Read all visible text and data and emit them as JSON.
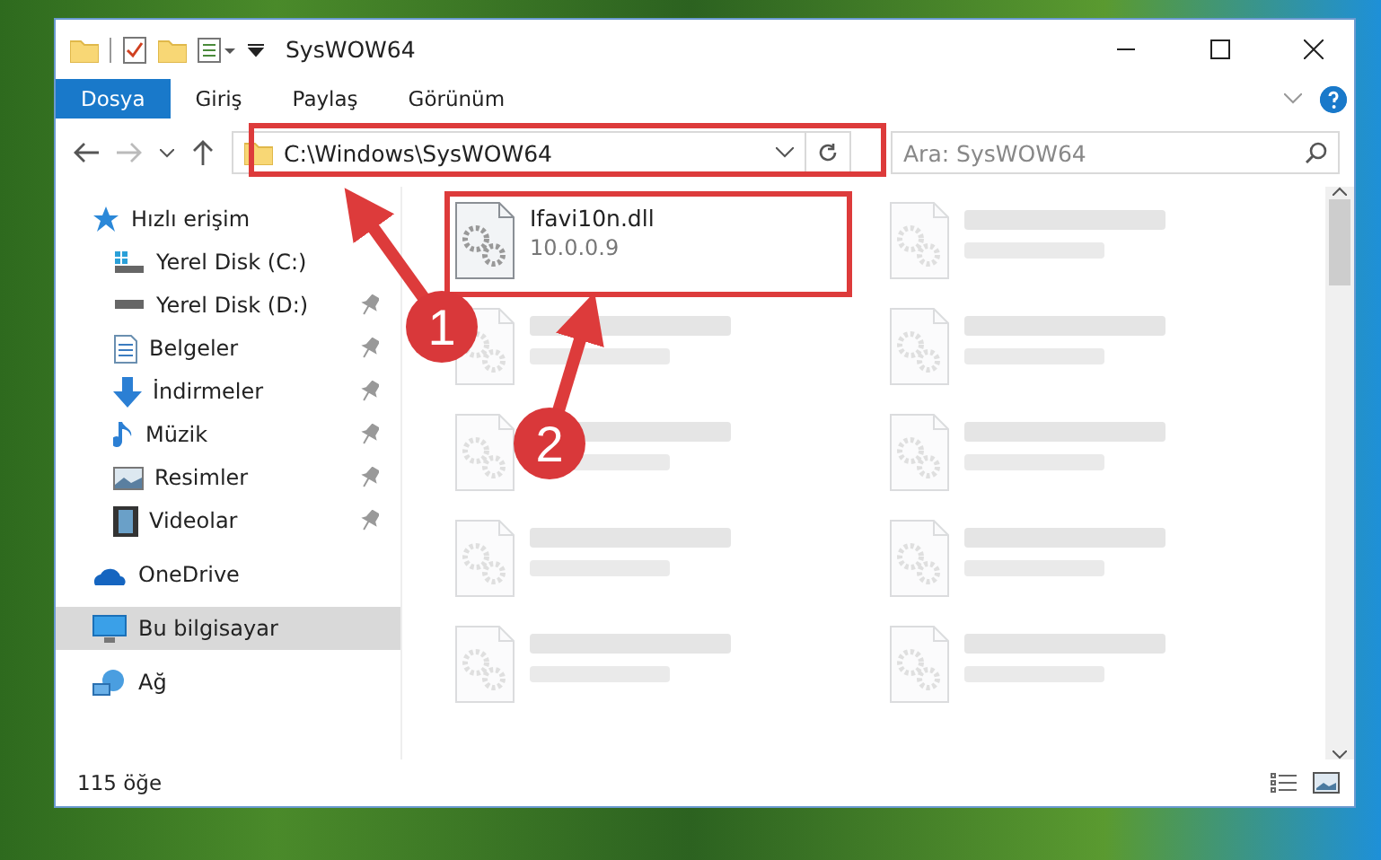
{
  "window": {
    "title": "SysWOW64"
  },
  "ribbon": {
    "tabs": [
      {
        "label": "Dosya",
        "selected": true
      },
      {
        "label": "Giriş",
        "selected": false
      },
      {
        "label": "Paylaş",
        "selected": false
      },
      {
        "label": "Görünüm",
        "selected": false
      }
    ]
  },
  "address_bar": {
    "path": "C:\\Windows\\SysWOW64"
  },
  "search": {
    "placeholder": "Ara: SysWOW64"
  },
  "sidebar": {
    "items": [
      {
        "label": "Hızlı erişim",
        "kind": "star",
        "selected": false,
        "children": [
          {
            "label": "Yerel Disk (C:)",
            "kind": "drive-win",
            "pinned": false,
            "selected": false
          },
          {
            "label": "Yerel Disk (D:)",
            "kind": "drive",
            "pinned": true,
            "selected": false
          },
          {
            "label": "Belgeler",
            "kind": "docs",
            "pinned": true,
            "selected": false
          },
          {
            "label": "İndirmeler",
            "kind": "download",
            "pinned": true,
            "selected": false
          },
          {
            "label": "Müzik",
            "kind": "music",
            "pinned": true,
            "selected": false
          },
          {
            "label": "Resimler",
            "kind": "pictures",
            "pinned": true,
            "selected": false
          },
          {
            "label": "Videolar",
            "kind": "video",
            "pinned": true,
            "selected": false
          }
        ]
      },
      {
        "label": "OneDrive",
        "kind": "cloud",
        "selected": false
      },
      {
        "label": "Bu bilgisayar",
        "kind": "pc",
        "selected": true
      },
      {
        "label": "Ağ",
        "kind": "network",
        "selected": false
      }
    ]
  },
  "files": [
    {
      "name": "Ifavi10n.dll",
      "detail": "10.0.0.9",
      "blurred": false
    },
    {
      "blurred": true
    },
    {
      "blurred": true
    },
    {
      "blurred": true
    },
    {
      "blurred": true
    },
    {
      "blurred": true
    },
    {
      "blurred": true
    },
    {
      "blurred": true
    },
    {
      "blurred": true
    },
    {
      "blurred": true
    }
  ],
  "status_bar": {
    "count": "115 öğe"
  },
  "annotations": [
    {
      "number": "1"
    },
    {
      "number": "2"
    }
  ]
}
